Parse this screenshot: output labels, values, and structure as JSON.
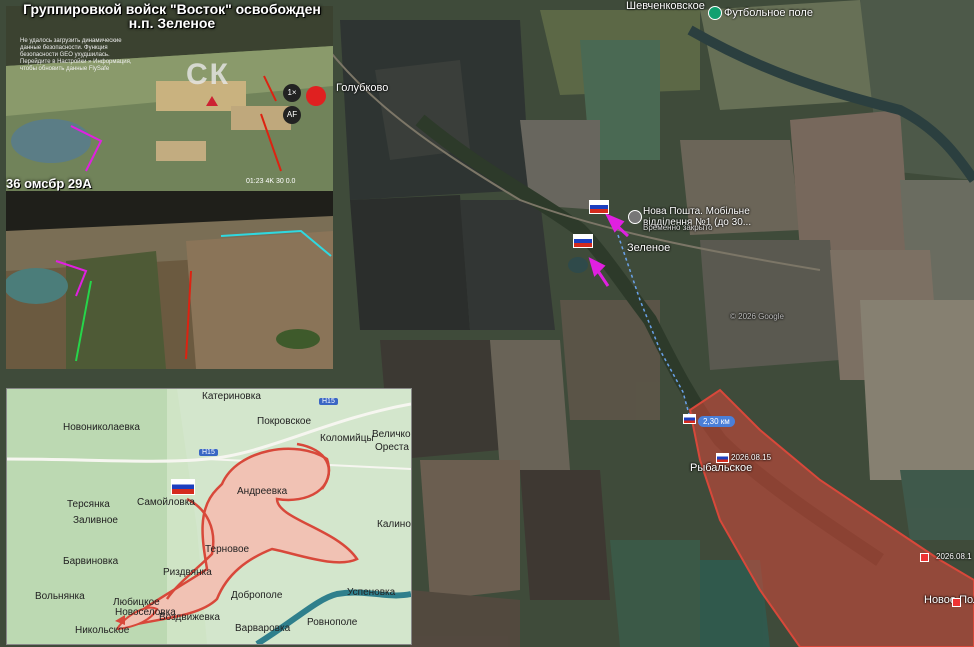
{
  "headline": {
    "line1": "Группировкой войск \"Восток\" освобожден",
    "line2": "н.п. Зеленое"
  },
  "drone_panel": {
    "unit_label": "36 омсбр 29А",
    "warning_text": "Не удалось загрузить динамические данные безопасности. Функция безопасности GEO ухудшилась. Перейдите в Настройки » Информация, чтобы обновить данные FlySafe",
    "big_letters": "СК",
    "button_1x": "1×",
    "button_af": "AF",
    "status_strip": "01:23  4K 30  0.0"
  },
  "satellite": {
    "places": [
      {
        "name": "Шевченковское"
      },
      {
        "name": "Футбольное поле"
      },
      {
        "name": "Голубково"
      },
      {
        "name": "Нова Пошта. Мобільне відділення №1 (до 30..."
      },
      {
        "name": "Временно закрыто"
      },
      {
        "name": "Зеленое"
      },
      {
        "name": "Рыбальское"
      },
      {
        "name": "Новое Пол"
      }
    ],
    "distance_label": "2,30 км",
    "date_label_1": "2026.08.15",
    "date_label_2": "2026.08.1",
    "copyright": "© 2026 Google"
  },
  "overview_map": {
    "road_labels": [
      "H15",
      "H15"
    ],
    "places": [
      {
        "name": "Катериновка"
      },
      {
        "name": "Новониколаевка"
      },
      {
        "name": "Покровское"
      },
      {
        "name": "Коломийцы"
      },
      {
        "name": "Величко"
      },
      {
        "name": "Ореста"
      },
      {
        "name": "Андреевка"
      },
      {
        "name": "Самойловка"
      },
      {
        "name": "Терсянка"
      },
      {
        "name": "Заливное"
      },
      {
        "name": "Калино"
      },
      {
        "name": "Терновое"
      },
      {
        "name": "Барвиновка"
      },
      {
        "name": "Риздвянка"
      },
      {
        "name": "Вольнянка"
      },
      {
        "name": "Доброполе"
      },
      {
        "name": "Успеновка"
      },
      {
        "name": "Любицкое"
      },
      {
        "name": "Воздвижевка"
      },
      {
        "name": "Новоселовка"
      },
      {
        "name": "Никольское"
      },
      {
        "name": "Варваровка"
      },
      {
        "name": "Ровнополе"
      }
    ]
  },
  "colors": {
    "front_red": "#d8483a",
    "front_fill": "#e8837a",
    "arrow_magenta": "#e020e0",
    "route_blue": "#6aa2ea",
    "river_blue": "#2f7f8c"
  }
}
